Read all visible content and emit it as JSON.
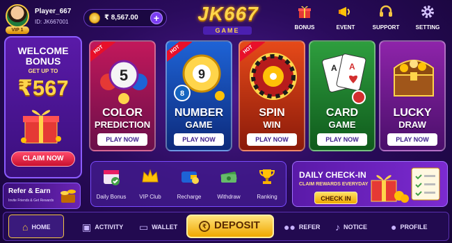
{
  "player": {
    "name": "Player_667",
    "id": "ID: JK667001",
    "vip": "VIP 1"
  },
  "wallet": {
    "currency_symbol": "₹",
    "balance": "8,567.00",
    "add": "+"
  },
  "logo": {
    "main": "JK667",
    "sub": "GAME"
  },
  "top_actions": [
    {
      "label": "BONUS",
      "icon": "gift-icon"
    },
    {
      "label": "EVENT",
      "icon": "megaphone-icon"
    },
    {
      "label": "SUPPORT",
      "icon": "headset-icon"
    },
    {
      "label": "SETTING",
      "icon": "gear-icon"
    }
  ],
  "welcome": {
    "line1": "WELCOME",
    "line2": "BONUS",
    "get": "GET UP TO",
    "amount": "₹567",
    "claim": "CLAIM NOW"
  },
  "refer": {
    "title": "Refer & Earn",
    "subtitle": "Invite Friends & Get Rewards"
  },
  "games": [
    {
      "line1": "COLOR",
      "line2": "PREDICTION",
      "play": "PLAY NOW",
      "hot": "HOT",
      "icon": "lottery-balls-icon",
      "color": "#c2185b"
    },
    {
      "line1": "NUMBER",
      "line2": "GAME",
      "play": "PLAY NOW",
      "hot": "HOT",
      "icon": "number-ball-icon",
      "color": "#1e63d6"
    },
    {
      "line1": "SPIN",
      "line2": "WIN",
      "play": "PLAY NOW",
      "hot": "HOT",
      "icon": "roulette-wheel-icon",
      "color": "#d84315"
    },
    {
      "line1": "CARD",
      "line2": "GAME",
      "play": "PLAY NOW",
      "icon": "playing-cards-icon",
      "color": "#2e9e3e"
    },
    {
      "line1": "LUCKY",
      "line2": "DRAW",
      "play": "PLAY NOW",
      "icon": "treasure-chest-icon",
      "color": "#8e24aa"
    }
  ],
  "features": [
    {
      "label": "Daily Bonus",
      "icon": "calendar-icon"
    },
    {
      "label": "VIP Club",
      "icon": "crown-icon"
    },
    {
      "label": "Recharge",
      "icon": "wallet-icon"
    },
    {
      "label": "Withdraw",
      "icon": "cash-icon"
    },
    {
      "label": "Ranking",
      "icon": "trophy-icon"
    }
  ],
  "checkin": {
    "title": "DAILY CHECK-IN",
    "subtitle": "CLAIM REWARDS EVERYDAY",
    "button": "CHECK IN"
  },
  "nav": [
    {
      "label": "HOME",
      "icon": "home-icon"
    },
    {
      "label": "ACTIVITY",
      "icon": "gift-icon"
    },
    {
      "label": "WALLET",
      "icon": "wallet-icon"
    },
    {
      "label": "DEPOSIT",
      "icon": "rupee-coin-icon"
    },
    {
      "label": "REFER",
      "icon": "users-icon"
    },
    {
      "label": "NOTICE",
      "icon": "bell-icon"
    },
    {
      "label": "PROFILE",
      "icon": "user-icon"
    }
  ]
}
